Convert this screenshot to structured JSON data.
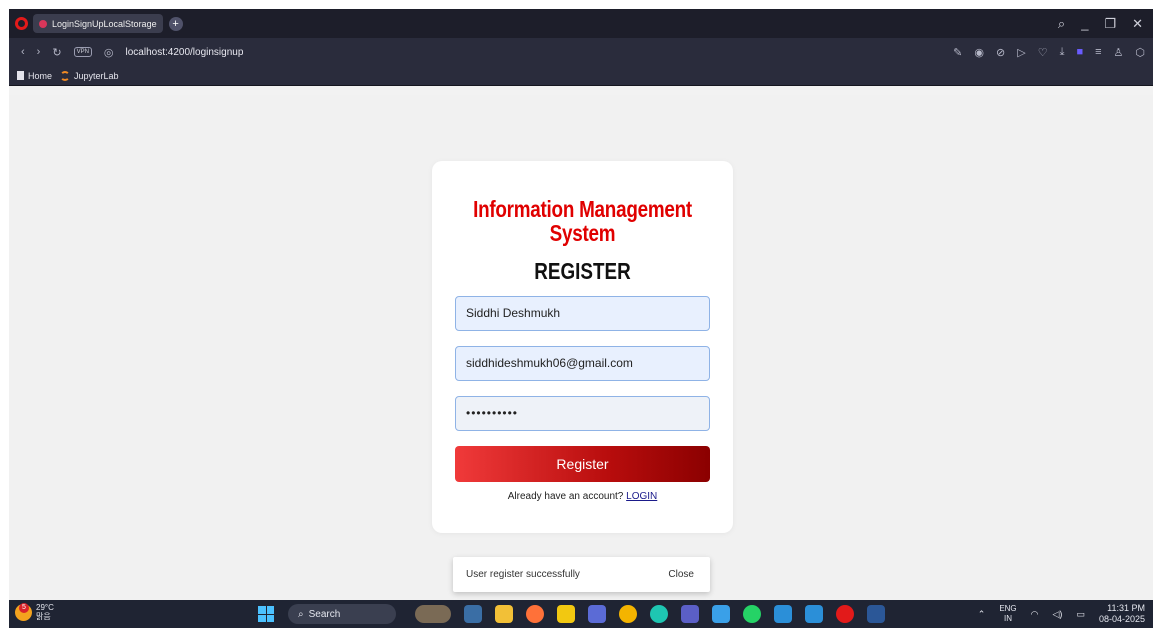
{
  "browser": {
    "tab_title": "LoginSignUpLocalStorage",
    "new_tab_symbol": "+",
    "url": "localhost:4200/loginsignup",
    "vpn_label": "VPN",
    "bookmarks": [
      {
        "label": "Home"
      },
      {
        "label": "JupyterLab"
      }
    ]
  },
  "form": {
    "title": "Information Management System",
    "heading": "REGISTER",
    "name_value": "Siddhi Deshmukh",
    "email_value": "siddhideshmukh06@gmail.com",
    "password_value": "••••••••••",
    "register_label": "Register",
    "login_prompt": "Already have an account?",
    "login_link": "LOGIN"
  },
  "toast": {
    "message": "User register successfully",
    "close_label": "Close"
  },
  "taskbar": {
    "weather_temp": "29°C",
    "weather_desc": "맑음",
    "weather_badge": "5",
    "search_label": "Search",
    "lang_top": "ENG",
    "lang_bottom": "IN",
    "time": "11:31 PM",
    "date": "08-04-2025"
  },
  "colors": {
    "title_red": "#e00000",
    "button_start": "#f03a3a",
    "button_end": "#8b0000",
    "tab_bar": "#1d1e2a"
  }
}
